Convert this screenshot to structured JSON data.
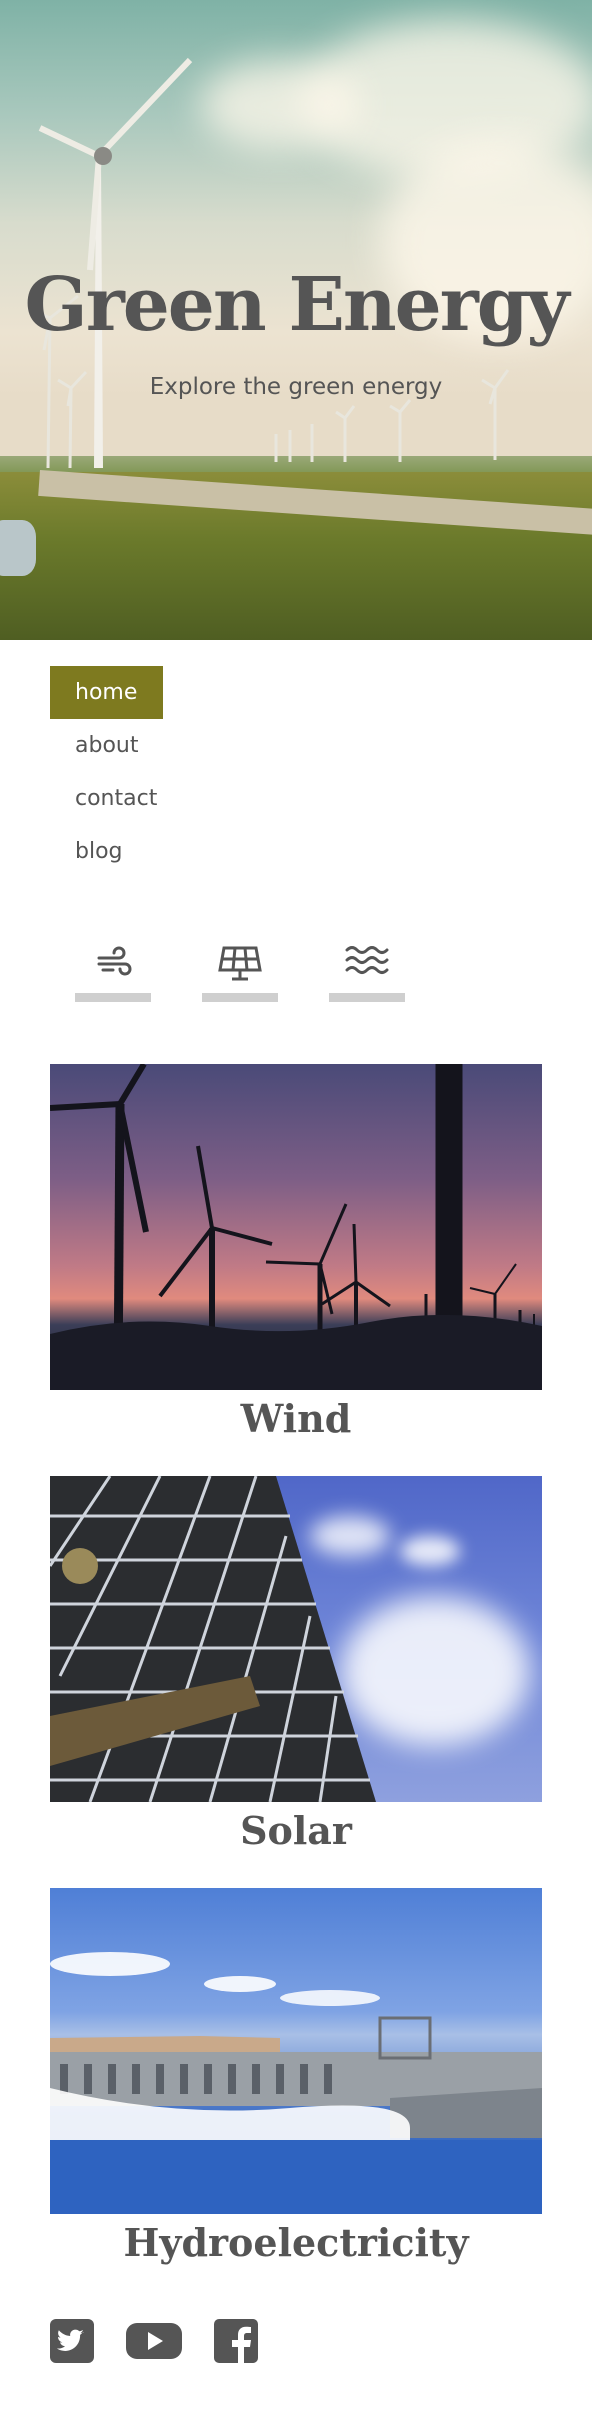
{
  "hero": {
    "title": "Green Energy",
    "subtitle": "Explore the green energy"
  },
  "nav": {
    "items": [
      {
        "label": "home",
        "active": true
      },
      {
        "label": "about",
        "active": false
      },
      {
        "label": "contact",
        "active": false
      },
      {
        "label": "blog",
        "active": false
      }
    ]
  },
  "tabs": [
    {
      "icon": "wind-icon"
    },
    {
      "icon": "solar-panel-icon"
    },
    {
      "icon": "water-waves-icon"
    }
  ],
  "cards": [
    {
      "caption": "Wind",
      "image": "wind-turbines-sunset-image"
    },
    {
      "caption": "Solar",
      "image": "solar-panel-sky-image"
    },
    {
      "caption": "Hydroelectricity",
      "image": "hydroelectric-dam-image"
    }
  ],
  "social": [
    {
      "icon": "twitter-icon"
    },
    {
      "icon": "youtube-icon"
    },
    {
      "icon": "facebook-icon"
    }
  ],
  "colors": {
    "accent": "#7e7a1f",
    "text": "#555555",
    "tab_bar": "#cfcfcf"
  }
}
